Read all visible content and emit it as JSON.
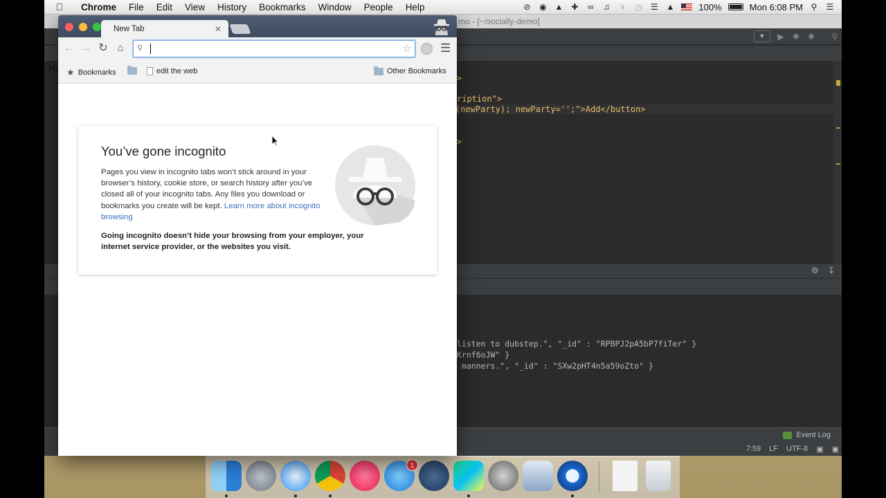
{
  "menubar": {
    "apple_icon": "apple-icon",
    "items": [
      "Chrome",
      "File",
      "Edit",
      "View",
      "History",
      "Bookmarks",
      "Window",
      "People",
      "Help"
    ],
    "battery_text": "100%",
    "clock": "Mon 6:08 PM"
  },
  "ide": {
    "title": "mo - [~/socially-demo]",
    "code_lines": [
      ">",
      "ription\">",
      "(newParty); newParty='';\">Add</button>",
      ">"
    ],
    "console_lines": [
      "listen to dubstep.\", \"_id\" : \"RPBPJ2pA5bP7fiTer\" }",
      "Krnf6oJW\" }",
      " manners.\", \"_id\" : \"SXw2pHT4n5a59oZto\" }"
    ],
    "event_log": "Event Log",
    "status": {
      "position": "7:59",
      "line_sep": "LF",
      "encoding": "UTF-8"
    }
  },
  "peek_text": "Na",
  "chrome": {
    "tab_title": "New Tab",
    "omnibox": {
      "value": "",
      "placeholder": ""
    },
    "bookmarks": {
      "bookmarks_label": "Bookmarks",
      "item": "edit the web",
      "other": "Other Bookmarks"
    },
    "incognito": {
      "heading": "You’ve gone incognito",
      "body": "Pages you view in incognito tabs won’t stick around in your browser’s history, cookie store, or search history after you’ve closed all of your incognito tabs. Any files you download or bookmarks you create will be kept.",
      "link": "Learn more about incognito browsing",
      "warning": "Going incognito doesn’t hide your browsing from your employer, your internet service provider, or the websites you visit."
    }
  },
  "dock": {
    "apps": [
      "finder-icon",
      "launchpad-icon",
      "safari-icon",
      "chrome-icon",
      "itunes-icon",
      "app-store-icon",
      "sourcetree-icon",
      "webstorm-icon",
      "system-preferences-icon",
      "keynote-icon",
      "quicktime-icon",
      "document-icon",
      "trash-icon"
    ],
    "app_store_badge": "1"
  },
  "colors": {
    "ide_bg": "#2b2b2b",
    "chrome_incognito_frame": "#4f5d73",
    "link": "#3b6fbf",
    "code_tag": "#e8bf6a"
  }
}
